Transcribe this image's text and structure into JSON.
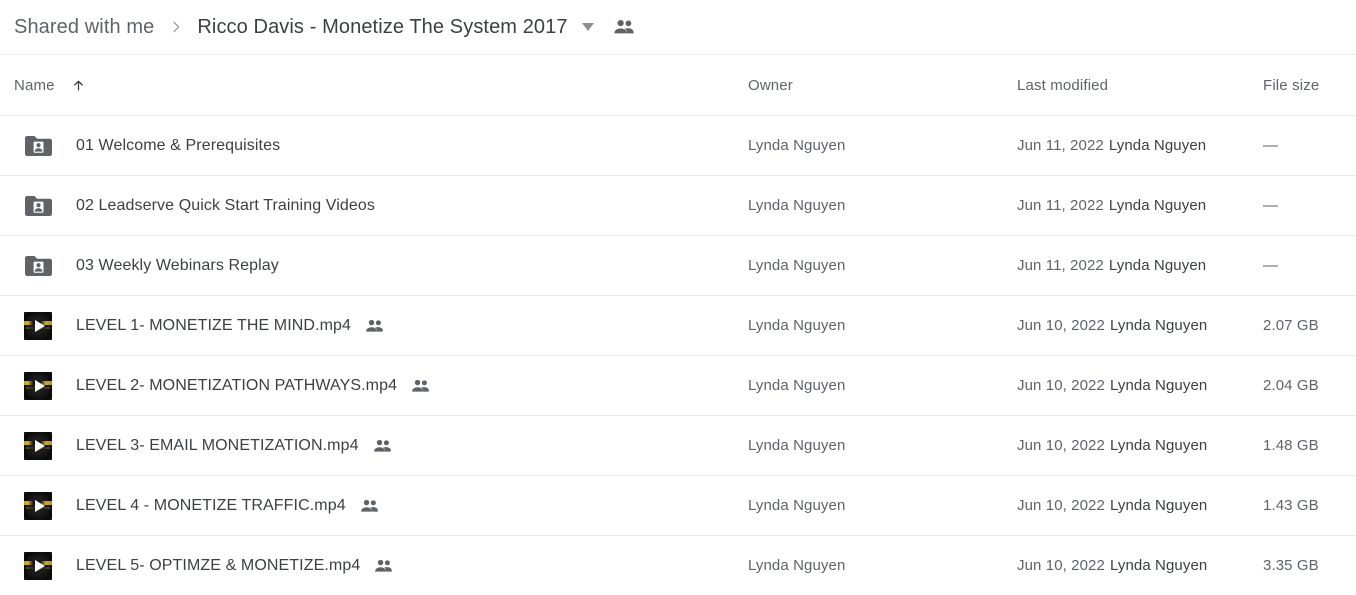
{
  "breadcrumb": {
    "root_label": "Shared with me",
    "separator_icon": "chevron-right-icon",
    "current_label": "Ricco Davis - Monetize The System 2017",
    "caret_icon": "chevron-down-icon",
    "people_icon": "people-shared-icon"
  },
  "table": {
    "columns": {
      "name": "Name",
      "owner": "Owner",
      "modified": "Last modified",
      "size": "File size"
    },
    "sort": {
      "column": "Name",
      "direction": "ascending",
      "icon": "arrow-up-icon"
    },
    "rows": [
      {
        "icon": "shared-folder-icon",
        "type": "folder",
        "name": "01 Welcome & Prerequisites",
        "shared": false,
        "owner": "Lynda Nguyen",
        "modified_date": "Jun 11, 2022",
        "modified_by": "Lynda Nguyen",
        "size": "—"
      },
      {
        "icon": "shared-folder-icon",
        "type": "folder",
        "name": "02 Leadserve Quick Start Training Videos",
        "shared": false,
        "owner": "Lynda Nguyen",
        "modified_date": "Jun 11, 2022",
        "modified_by": "Lynda Nguyen",
        "size": "—"
      },
      {
        "icon": "shared-folder-icon",
        "type": "folder",
        "name": "03 Weekly Webinars Replay",
        "shared": false,
        "owner": "Lynda Nguyen",
        "modified_date": "Jun 11, 2022",
        "modified_by": "Lynda Nguyen",
        "size": "—"
      },
      {
        "icon": "video-thumbnail-icon",
        "type": "video",
        "name": "LEVEL 1- MONETIZE THE MIND.mp4",
        "shared": true,
        "share_icon": "people-shared-icon",
        "owner": "Lynda Nguyen",
        "modified_date": "Jun 10, 2022",
        "modified_by": "Lynda Nguyen",
        "size": "2.07 GB"
      },
      {
        "icon": "video-thumbnail-icon",
        "type": "video",
        "name": "LEVEL 2- MONETIZATION PATHWAYS.mp4",
        "shared": true,
        "share_icon": "people-shared-icon",
        "owner": "Lynda Nguyen",
        "modified_date": "Jun 10, 2022",
        "modified_by": "Lynda Nguyen",
        "size": "2.04 GB"
      },
      {
        "icon": "video-thumbnail-icon",
        "type": "video",
        "name": "LEVEL 3- EMAIL MONETIZATION.mp4",
        "shared": true,
        "share_icon": "people-shared-icon",
        "owner": "Lynda Nguyen",
        "modified_date": "Jun 10, 2022",
        "modified_by": "Lynda Nguyen",
        "size": "1.48 GB"
      },
      {
        "icon": "video-thumbnail-icon",
        "type": "video",
        "name": "LEVEL 4 - MONETIZE TRAFFIC.mp4",
        "shared": true,
        "share_icon": "people-shared-icon",
        "owner": "Lynda Nguyen",
        "modified_date": "Jun 10, 2022",
        "modified_by": "Lynda Nguyen",
        "size": "1.43 GB"
      },
      {
        "icon": "video-thumbnail-icon",
        "type": "video",
        "name": "LEVEL 5- OPTIMZE & MONETIZE.mp4",
        "shared": true,
        "share_icon": "people-shared-icon",
        "owner": "Lynda Nguyen",
        "modified_date": "Jun 10, 2022",
        "modified_by": "Lynda Nguyen",
        "size": "3.35 GB"
      }
    ]
  },
  "colors": {
    "text_primary": "#3c4043",
    "text_secondary": "#5f6368",
    "divider": "#e8eaed",
    "icon_gray": "#5f6368",
    "background": "#ffffff"
  }
}
